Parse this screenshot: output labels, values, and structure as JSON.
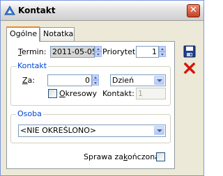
{
  "window": {
    "title": "Kontakt",
    "close_label": "✕"
  },
  "tabs": [
    {
      "label": "Ogólne"
    },
    {
      "label": "Notatka"
    }
  ],
  "termin": {
    "label_u": "T",
    "label_rest": "ermin:",
    "value": "2011-05-05"
  },
  "priorytet": {
    "label": "Priorytet:",
    "value": "1"
  },
  "kontakt_group": {
    "title": "Kontakt",
    "za_label_u": "Z",
    "za_label_rest": "a:",
    "za_value": "0",
    "unit_value": "Dzień",
    "okresowy_label_u": "O",
    "okresowy_label_rest": "kresowy",
    "kontakt_label": "Kontakt:",
    "kontakt_value": "1"
  },
  "osoba_group": {
    "title": "Osoba",
    "value": "<NIE OKREŚLONO>"
  },
  "sprawa": {
    "label_pre": "Sprawa za",
    "label_u": "k",
    "label_post": "ończona"
  },
  "buttons": {
    "save": "save-icon",
    "cancel": "cancel-icon"
  },
  "colors": {
    "accent": "#0046d5",
    "tab_highlight": "#e68b2c",
    "cancel_red": "#d4150b"
  }
}
